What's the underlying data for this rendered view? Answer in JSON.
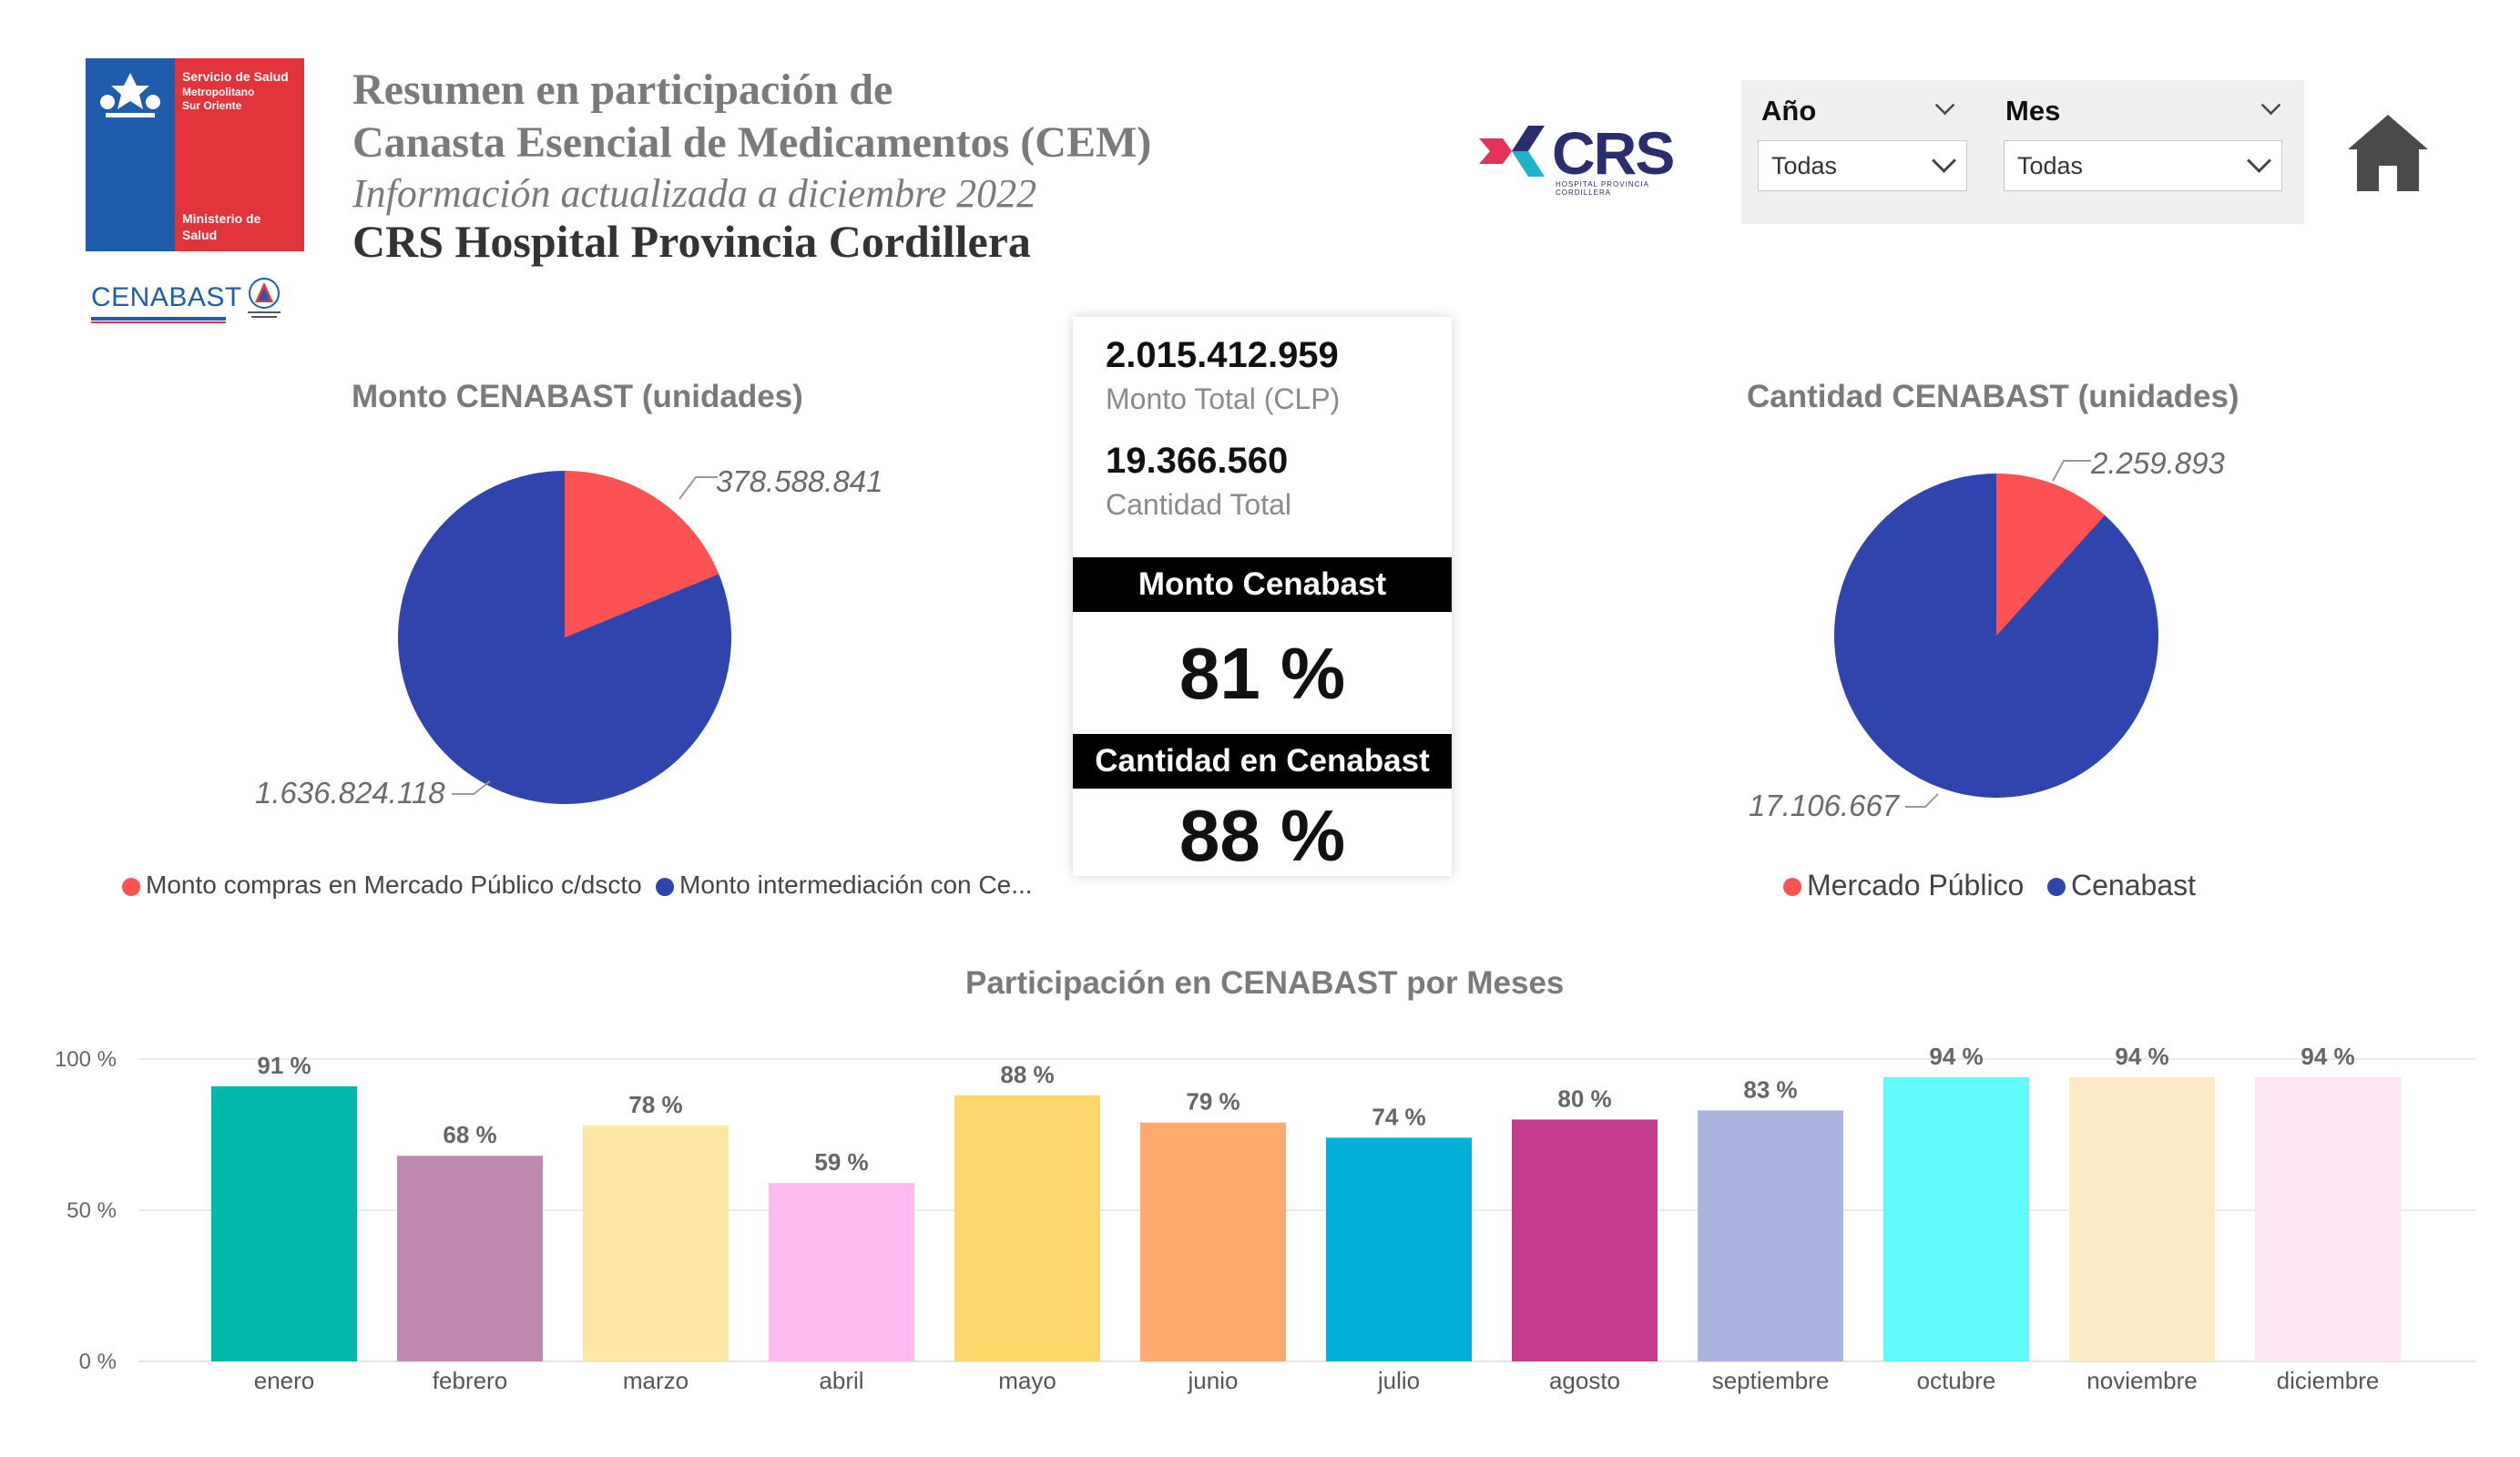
{
  "header": {
    "title_line1": "Resumen en participación de",
    "title_line2": "Canasta Esencial de Medicamentos (CEM)",
    "subtitle": "Información actualizada a diciembre 2022",
    "hospital": "CRS Hospital Provincia Cordillera",
    "gov_logo": {
      "line1": "Servicio de Salud",
      "line2": "Metropolitano",
      "line3": "Sur Oriente",
      "line4": "Ministerio de",
      "line5": "Salud"
    },
    "cenabast_logo": "CENABAST",
    "crs_logo": {
      "text": "CRS",
      "sub": "HOSPITAL PROVINCIA CORDILLERA"
    }
  },
  "filters": {
    "year": {
      "label": "Año",
      "value": "Todas"
    },
    "month": {
      "label": "Mes",
      "value": "Todas"
    }
  },
  "colors": {
    "red": "#fd5252",
    "blue": "#2f44ad",
    "title_gray": "#7a7a7a"
  },
  "icons": {
    "home": "home-icon",
    "dropdown": "chevron-down-icon"
  },
  "kpis": {
    "monto_total_value": "2.015.412.959",
    "monto_total_label": "Monto Total (CLP)",
    "cantidad_total_value": "19.366.560",
    "cantidad_total_label": "Cantidad Total",
    "monto_cenabast_title": "Monto Cenabast",
    "monto_cenabast_pct": "81 %",
    "cantidad_cenabast_title": "Cantidad en Cenabast",
    "cantidad_cenabast_pct": "88 %"
  },
  "chart_data": [
    {
      "type": "pie",
      "title": "Monto CENABAST (unidades)",
      "slices": [
        {
          "name": "Monto compras en Mercado Público c/dscto",
          "value": 378588841,
          "label": "378.588.841",
          "color": "#fd5252"
        },
        {
          "name": "Monto intermediación con Ce...",
          "value": 1636824118,
          "label": "1.636.824.118",
          "color": "#2f44ad"
        }
      ]
    },
    {
      "type": "pie",
      "title": "Cantidad CENABAST (unidades)",
      "slices": [
        {
          "name": "Mercado Público",
          "value": 2259893,
          "label": "2.259.893",
          "color": "#fd5252"
        },
        {
          "name": "Cenabast",
          "value": 17106667,
          "label": "17.106.667",
          "color": "#2f44ad"
        }
      ]
    },
    {
      "type": "bar",
      "title": "Participación en CENABAST por Meses",
      "categories": [
        "enero",
        "febrero",
        "marzo",
        "abril",
        "mayo",
        "junio",
        "julio",
        "agosto",
        "septiembre",
        "octubre",
        "noviembre",
        "diciembre"
      ],
      "values": [
        91,
        68,
        78,
        59,
        88,
        79,
        74,
        80,
        83,
        94,
        94,
        94
      ],
      "labels": [
        "91 %",
        "68 %",
        "78 %",
        "59 %",
        "88 %",
        "79 %",
        "74 %",
        "80 %",
        "83 %",
        "94 %",
        "94 %",
        "94 %"
      ],
      "colors": [
        "#01b8aa",
        "#bf88b0",
        "#fde7a6",
        "#fdbbf0",
        "#fed86c",
        "#fea96e",
        "#00b0d8",
        "#c43c90",
        "#abb4de",
        "#61fafa",
        "#fdeac5",
        "#fde5f3"
      ],
      "yticks": [
        "100 %",
        "50 %",
        "0 %"
      ],
      "ylim": [
        0,
        100
      ],
      "grid": true
    }
  ]
}
